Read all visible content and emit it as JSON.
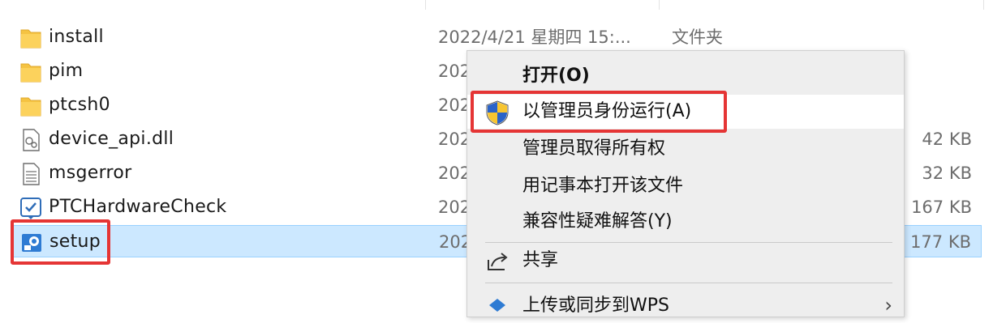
{
  "files": [
    {
      "name": "install",
      "date": "2022/4/21 星期四 15:...",
      "type": "文件夹",
      "size": "",
      "icon": "folder-icon"
    },
    {
      "name": "pim",
      "date": "202",
      "type": "",
      "size": "",
      "icon": "folder-icon"
    },
    {
      "name": "ptcsh0",
      "date": "202",
      "type": "",
      "size": "",
      "icon": "folder-icon"
    },
    {
      "name": "device_api.dll",
      "date": "202",
      "type": "",
      "size": "42 KB",
      "icon": "dll-file-icon"
    },
    {
      "name": "msgerror",
      "date": "202",
      "type": "",
      "size": "32 KB",
      "icon": "text-file-icon"
    },
    {
      "name": "PTCHardwareCheck",
      "date": "202",
      "type": "",
      "size": "167 KB",
      "icon": "app-check-icon"
    },
    {
      "name": "setup",
      "date": "202",
      "type": "",
      "size": "177 KB",
      "icon": "setup-app-icon"
    }
  ],
  "context_menu": {
    "items": [
      {
        "label": "打开(O)",
        "bold": true,
        "icon": ""
      },
      {
        "label": "以管理员身份运行(A)",
        "bold": false,
        "icon": "uac-shield-icon"
      },
      {
        "label": "管理员取得所有权",
        "bold": false,
        "icon": ""
      },
      {
        "label": "用记事本打开该文件",
        "bold": false,
        "icon": ""
      },
      {
        "label": "兼容性疑难解答(Y)",
        "bold": false,
        "icon": ""
      },
      {
        "label": "共享",
        "bold": false,
        "icon": "share-icon"
      },
      {
        "label": "上传或同步到WPS",
        "bold": false,
        "icon": "wps-cloud-icon"
      }
    ]
  },
  "colors": {
    "selection": "#cce8ff",
    "highlight_box": "#e53535",
    "menu_bg": "#eeeeee",
    "folder": "#f5c342"
  }
}
